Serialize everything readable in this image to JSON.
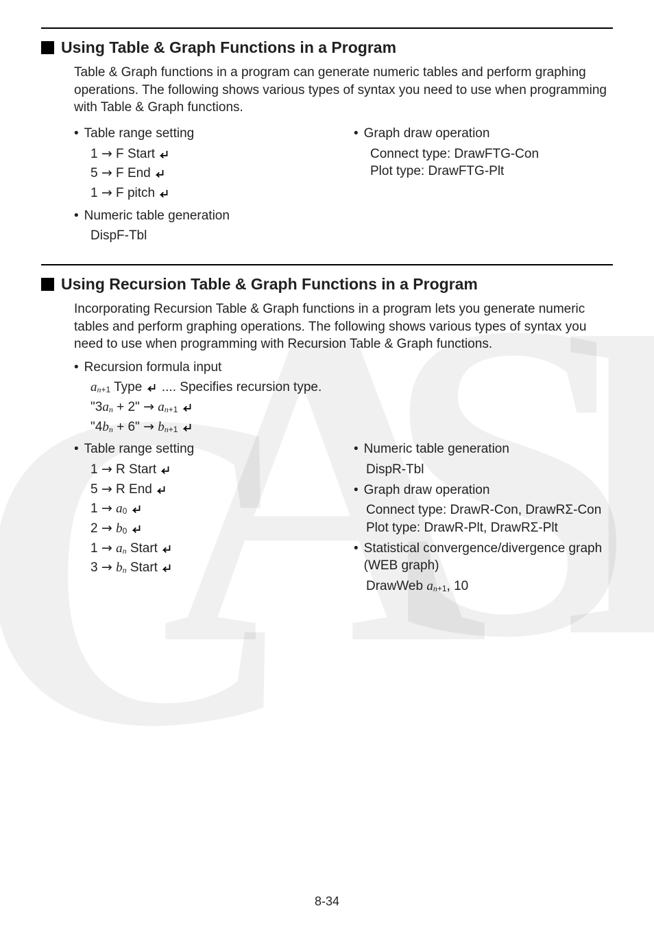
{
  "sec1": {
    "title": "Using Table & Graph Functions in a Program",
    "intro": "Table & Graph functions in a program can generate numeric tables and perform graphing operations. The following shows various types of syntax you need to use when programming with Table & Graph functions.",
    "left": {
      "b1": "Table range setting",
      "l1a": "1 ",
      "l1b": " F  Start ",
      "l2a": "5 ",
      "l2b": " F  End ",
      "l3a": "1 ",
      "l3b": " F  pitch ",
      "b2": "Numeric table generation",
      "l4": "DispF-Tbl"
    },
    "right": {
      "b1": "Graph draw operation",
      "l1": "Connect type: DrawFTG-Con",
      "l2": "Plot type: DrawFTG-Plt"
    }
  },
  "sec2": {
    "title": "Using Recursion Table & Graph Functions in a Program",
    "intro": "Incorporating Recursion Table & Graph functions in a program lets you generate numeric tables and perform graphing operations. The following shows various types of syntax you need to use when programming with Recursion Table & Graph functions.",
    "pre": {
      "b1": "Recursion formula input",
      "l1a_pre": "  Type ",
      "l1a_post": "  .... Specifies recursion type.",
      "l2pre": "\"3",
      "l2mid": " + 2\" ",
      "l3pre": "\"4",
      "l3mid": " + 6\" "
    },
    "left": {
      "b1": "Table range setting",
      "l1a": "1 ",
      "l1b": " R  Start ",
      "l2a": "5 ",
      "l2b": " R  End ",
      "l3a": "1 ",
      "l4a": "2 ",
      "l5a": "1 ",
      "l5b_post": " Start ",
      "l6a": "3 ",
      "l6b_post": " Start "
    },
    "right": {
      "b1": "Numeric table generation",
      "l1": "DispR-Tbl",
      "b2": "Graph draw operation",
      "l2": "Connect type: DrawR-Con, DrawRΣ-Con",
      "l3": "Plot type: DrawR-Plt, DrawRΣ-Plt",
      "b3a": "Statistical convergence/divergence graph",
      "b3b": "(WEB graph)",
      "l4a": "DrawWeb ",
      "l4b": ", 10"
    }
  },
  "footer": "8-34"
}
